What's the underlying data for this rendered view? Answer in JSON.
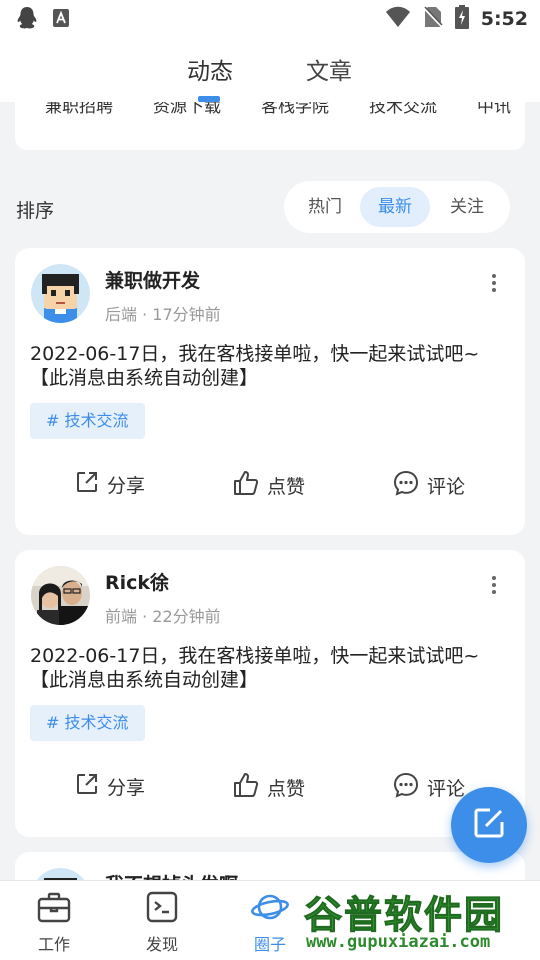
{
  "status_bar": {
    "time": "5:52"
  },
  "top_tabs": [
    {
      "label": "动态"
    },
    {
      "label": "文章"
    }
  ],
  "categories": [
    "兼职招聘",
    "资源下载",
    "客栈学院",
    "技术交流",
    "中讯"
  ],
  "sort": {
    "label": "排序",
    "options": [
      "热门",
      "最新",
      "关注"
    ],
    "selected": "最新"
  },
  "posts": [
    {
      "name": "兼职做开发",
      "meta": "后端 · 17分钟前",
      "content": "2022-06-17日，我在客栈接单啦，快一起来试试吧~【此消息由系统自动创建】",
      "tag": "# 技术交流",
      "actions": {
        "share": "分享",
        "like": "点赞",
        "comment": "评论"
      }
    },
    {
      "name": "Rick徐",
      "meta": "前端 · 22分钟前",
      "content": "2022-06-17日，我在客栈接单啦，快一起来试试吧~【此消息由系统自动创建】",
      "tag": "# 技术交流",
      "actions": {
        "share": "分享",
        "like": "点赞",
        "comment": "评论"
      }
    },
    {
      "name": "我不想掉头发啊"
    }
  ],
  "bottom_nav": [
    {
      "label": "工作"
    },
    {
      "label": "发现"
    },
    {
      "label": "圈子"
    }
  ],
  "watermark": {
    "title": "谷普软件园",
    "url": "www.gupuxiazai.com"
  },
  "colors": {
    "accent": "#3d8ee8",
    "tag_bg": "#e6f0fb",
    "page_bg": "#f2f3f5"
  }
}
